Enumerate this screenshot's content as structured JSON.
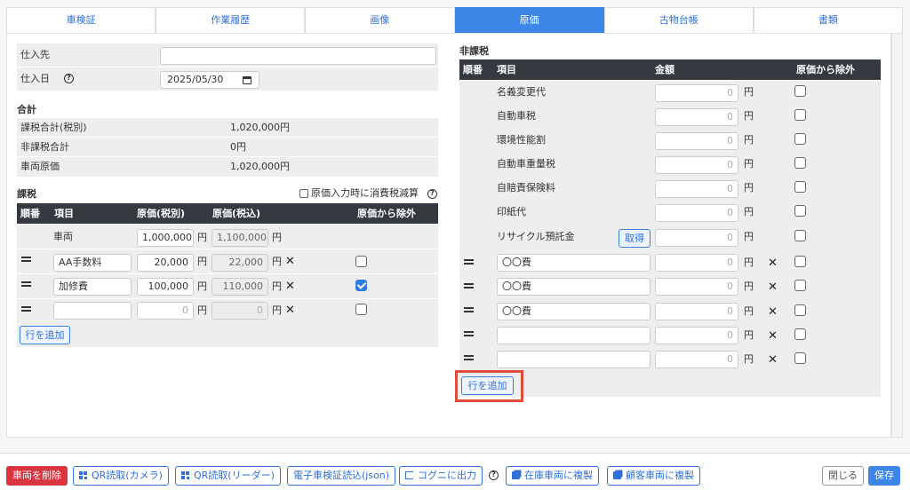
{
  "tabs": [
    "車検証",
    "作業履歴",
    "画像",
    "原価",
    "古物台帳",
    "書類"
  ],
  "active_tab": "原価",
  "purchase": {
    "supplier_label": "仕入先",
    "supplier_value": "",
    "date_label": "仕入日",
    "date_value": "2025/05/30"
  },
  "totals": {
    "heading": "合計",
    "rows": [
      {
        "label": "課税合計(税別)",
        "value": "1,020,000円"
      },
      {
        "label": "非課税合計",
        "value": "0円"
      },
      {
        "label": "車両原価",
        "value": "1,020,000円"
      }
    ]
  },
  "taxable": {
    "heading": "課税",
    "tax_reduce_label": "原価入力時に消費税減算",
    "tax_reduce_checked": false,
    "headers": [
      "順番",
      "項目",
      "原価(税別)",
      "原価(税込)",
      "原価から除外"
    ],
    "vehicle_row": {
      "item": "車両",
      "cost_ex": "1,000,000",
      "cost_in": "1,100,000"
    },
    "rows": [
      {
        "item": "AA手数料",
        "cost_ex": "20,000",
        "cost_in": "22,000",
        "exclude": false
      },
      {
        "item": "加修費",
        "cost_ex": "100,000",
        "cost_in": "110,000",
        "exclude": true
      },
      {
        "item": "",
        "cost_ex": "0",
        "cost_in": "0",
        "exclude": false
      }
    ],
    "add_row_label": "行を追加"
  },
  "nontaxable": {
    "heading": "非課税",
    "headers": [
      "順番",
      "項目",
      "金額",
      "原価から除外"
    ],
    "fixed_rows": [
      {
        "item": "名義変更代",
        "amount": "0",
        "exclude": false
      },
      {
        "item": "自動車税",
        "amount": "0",
        "exclude": false
      },
      {
        "item": "環境性能割",
        "amount": "0",
        "exclude": false
      },
      {
        "item": "自動車重量税",
        "amount": "0",
        "exclude": false
      },
      {
        "item": "自賠責保険料",
        "amount": "0",
        "exclude": false
      },
      {
        "item": "印紙代",
        "amount": "0",
        "exclude": false
      },
      {
        "item": "リサイクル預託金",
        "amount": "0",
        "exclude": false
      }
    ],
    "fetch_label": "取得",
    "custom_rows": [
      {
        "item": "〇〇費",
        "amount": "0",
        "exclude": false
      },
      {
        "item": "〇〇費",
        "amount": "0",
        "exclude": false
      },
      {
        "item": "〇〇費",
        "amount": "0",
        "exclude": false
      },
      {
        "item": "",
        "amount": "0",
        "exclude": false
      },
      {
        "item": "",
        "amount": "0",
        "exclude": false
      }
    ],
    "add_row_label": "行を追加"
  },
  "yen": "円",
  "footer": {
    "delete": "車両を削除",
    "qr_camera": "QR読取(カメラ)",
    "qr_reader": "QR読取(リーダー)",
    "ev_json": "電子車検証読込(json)",
    "export": "コグニに出力",
    "copy_stock": "在庫車両に複製",
    "copy_customer": "顧客車両に複製",
    "close": "閉じる",
    "save": "保存"
  }
}
